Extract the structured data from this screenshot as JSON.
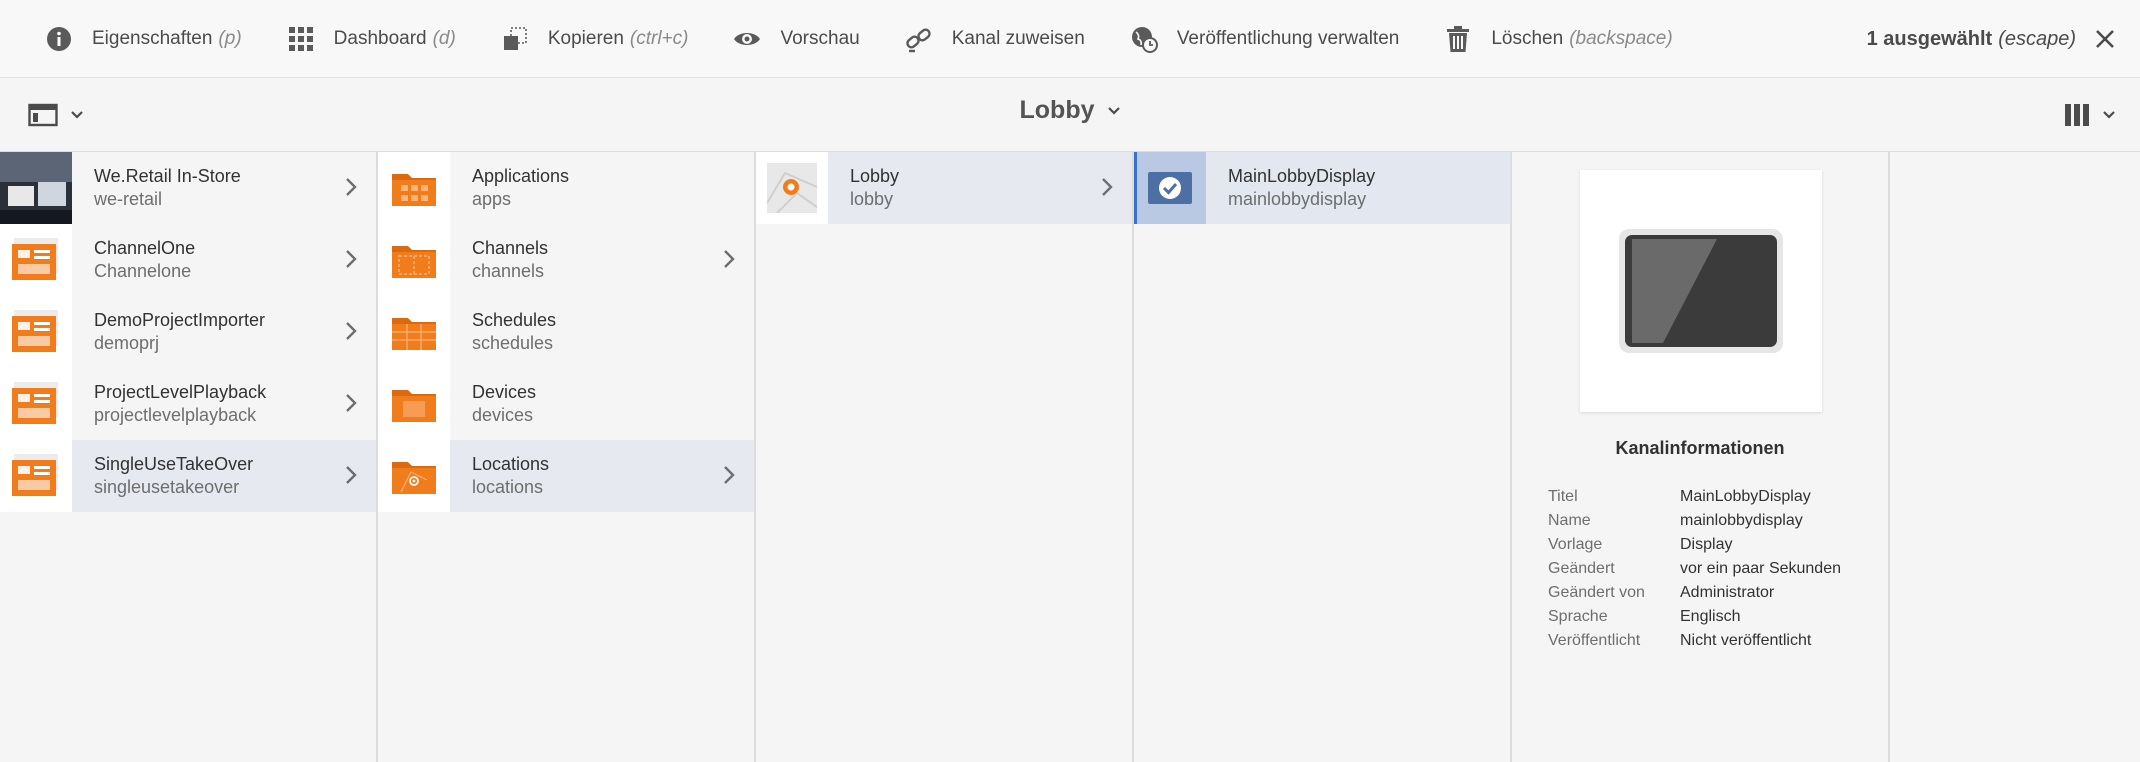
{
  "actionbar": {
    "items": [
      {
        "label": "Eigenschaften",
        "hint": "(p)",
        "icon": "info-icon"
      },
      {
        "label": "Dashboard",
        "hint": "(d)",
        "icon": "dashboard-grid-icon"
      },
      {
        "label": "Kopieren",
        "hint": "(ctrl+c)",
        "icon": "copy-icon"
      },
      {
        "label": "Vorschau",
        "hint": "",
        "icon": "eye-icon"
      },
      {
        "label": "Kanal zuweisen",
        "hint": "",
        "icon": "link-icon"
      },
      {
        "label": "Veröffentlichung verwalten",
        "hint": "",
        "icon": "globe-clock-icon"
      },
      {
        "label": "Löschen",
        "hint": "(backspace)",
        "icon": "trash-icon"
      }
    ],
    "selection": {
      "label": "1 ausgewählt",
      "hint": "(escape)"
    }
  },
  "titlebar": {
    "title": "Lobby"
  },
  "columns": [
    {
      "items": [
        {
          "title": "We.Retail In-Store",
          "name": "we-retail",
          "thumb": "photo",
          "arrow": true,
          "active": false
        },
        {
          "title": "ChannelOne",
          "name": "Channelone",
          "thumb": "project",
          "arrow": true,
          "active": false
        },
        {
          "title": "DemoProjectImporter",
          "name": "demoprj",
          "thumb": "project",
          "arrow": true,
          "active": false
        },
        {
          "title": "ProjectLevelPlayback",
          "name": "projectlevelplayback",
          "thumb": "project",
          "arrow": true,
          "active": false
        },
        {
          "title": "SingleUseTakeOver",
          "name": "singleusetakeover",
          "thumb": "project",
          "arrow": true,
          "active": true
        }
      ]
    },
    {
      "items": [
        {
          "title": "Applications",
          "name": "apps",
          "thumb": "folder-apps",
          "arrow": false,
          "active": false
        },
        {
          "title": "Channels",
          "name": "channels",
          "thumb": "folder-channels",
          "arrow": true,
          "active": false
        },
        {
          "title": "Schedules",
          "name": "schedules",
          "thumb": "folder-schedules",
          "arrow": false,
          "active": false
        },
        {
          "title": "Devices",
          "name": "devices",
          "thumb": "folder-devices",
          "arrow": false,
          "active": false
        },
        {
          "title": "Locations",
          "name": "locations",
          "thumb": "folder-locations",
          "arrow": true,
          "active": true
        }
      ]
    },
    {
      "items": [
        {
          "title": "Lobby",
          "name": "lobby",
          "thumb": "location-map",
          "arrow": true,
          "active": true
        }
      ]
    },
    {
      "items": [
        {
          "title": "MainLobbyDisplay",
          "name": "mainlobbydisplay",
          "thumb": "display-check",
          "arrow": false,
          "active": true
        }
      ]
    }
  ],
  "preview": {
    "heading": "Kanalinformationen",
    "fields": [
      {
        "key": "Titel",
        "value": "MainLobbyDisplay"
      },
      {
        "key": "Name",
        "value": "mainlobbydisplay"
      },
      {
        "key": "Vorlage",
        "value": "Display"
      },
      {
        "key": "Geändert",
        "value": "vor ein paar Sekunden"
      },
      {
        "key": "Geändert von",
        "value": "Administrator"
      },
      {
        "key": "Sprache",
        "value": "Englisch"
      },
      {
        "key": "Veröffentlicht",
        "value": "Nicht veröffentlicht"
      }
    ]
  },
  "colors": {
    "accent": "#3a72c7",
    "folder": "#f07c1b",
    "active_row": "#e6e9ef"
  }
}
